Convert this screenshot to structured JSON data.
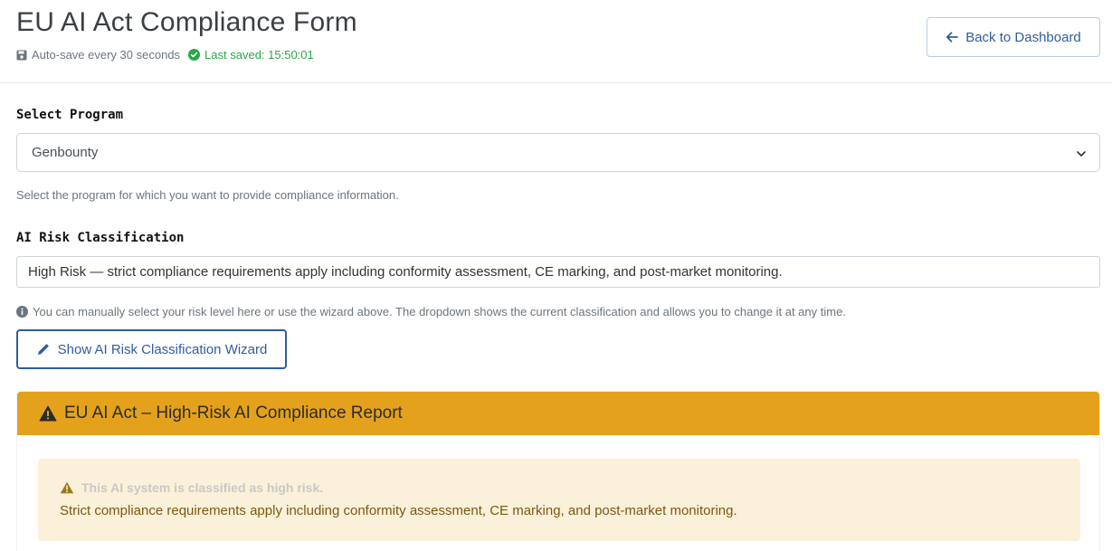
{
  "header": {
    "title": "EU AI Act Compliance Form",
    "autosave_text": "Auto-save every 30 seconds",
    "last_saved_text": "Last saved: 15:50:01",
    "back_button_label": "Back to Dashboard"
  },
  "program": {
    "label": "Select Program",
    "selected_value": "Genbounty",
    "help_text": "Select the program for which you want to provide compliance information."
  },
  "risk": {
    "label": "AI Risk Classification",
    "selected_value": "High Risk — strict compliance requirements apply including conformity assessment, CE marking, and post-market monitoring.",
    "help_text": "You can manually select your risk level here or use the wizard above. The dropdown shows the current classification and allows you to change it at any time.",
    "wizard_button_label": "Show AI Risk Classification Wizard"
  },
  "report": {
    "header_title": "EU AI Act – High-Risk AI Compliance Report",
    "alert_title": "This AI system is classified as high risk.",
    "alert_body": "Strict compliance requirements apply including conformity assessment, CE marking, and post-market monitoring."
  },
  "colors": {
    "accent_blue": "#2f5d9e",
    "success_green": "#28a745",
    "warning_orange": "#e4a11b",
    "alert_background": "#fbf0d9"
  },
  "icons": [
    "save-icon",
    "check-circle-icon",
    "arrow-left-icon",
    "chevron-down-icon",
    "info-icon",
    "pencil-icon",
    "warning-icon"
  ]
}
